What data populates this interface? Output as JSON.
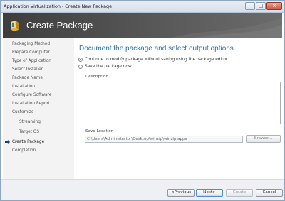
{
  "window": {
    "title": "Application Virtualization - Create New Package",
    "controls": {
      "minimize": "–",
      "maximize": "□",
      "close": "×"
    }
  },
  "header": {
    "title": "Create Package",
    "colors": {
      "banner_dark": "#3d3d3d",
      "banner_light": "#6b6b6b"
    }
  },
  "sidebar": {
    "items": [
      {
        "label": "Packaging Method"
      },
      {
        "label": "Prepare Computer"
      },
      {
        "label": "Type of Application"
      },
      {
        "label": "Select Installer"
      },
      {
        "label": "Package Name"
      },
      {
        "label": "Installation"
      },
      {
        "label": "Configure Software"
      },
      {
        "label": "Installation Report"
      },
      {
        "label": "Customize"
      },
      {
        "label": "Streaming"
      },
      {
        "label": "Target OS"
      },
      {
        "label": "Create Package"
      },
      {
        "label": "Completion"
      }
    ],
    "current": "Create Package"
  },
  "main": {
    "heading": "Document the package and select output options.",
    "options": [
      {
        "label": "Continue to modify package without saving using the package editor.",
        "selected": true
      },
      {
        "label": "Save the package now.",
        "selected": false
      }
    ],
    "description_label": "Description",
    "description_value": "",
    "save_location_label": "Save Location",
    "save_location_value": "C:\\Users\\Administrator\\Desktop\\winzip\\winzip.appv",
    "browse_label": "Browse..."
  },
  "footer": {
    "previous_label": "<Previous",
    "next_label": "Next>",
    "create_label": "Create",
    "cancel_label": "Cancel"
  },
  "colors": {
    "heading_blue": "#2a6fb0",
    "sidebar_bg": "#f3f3f3"
  }
}
